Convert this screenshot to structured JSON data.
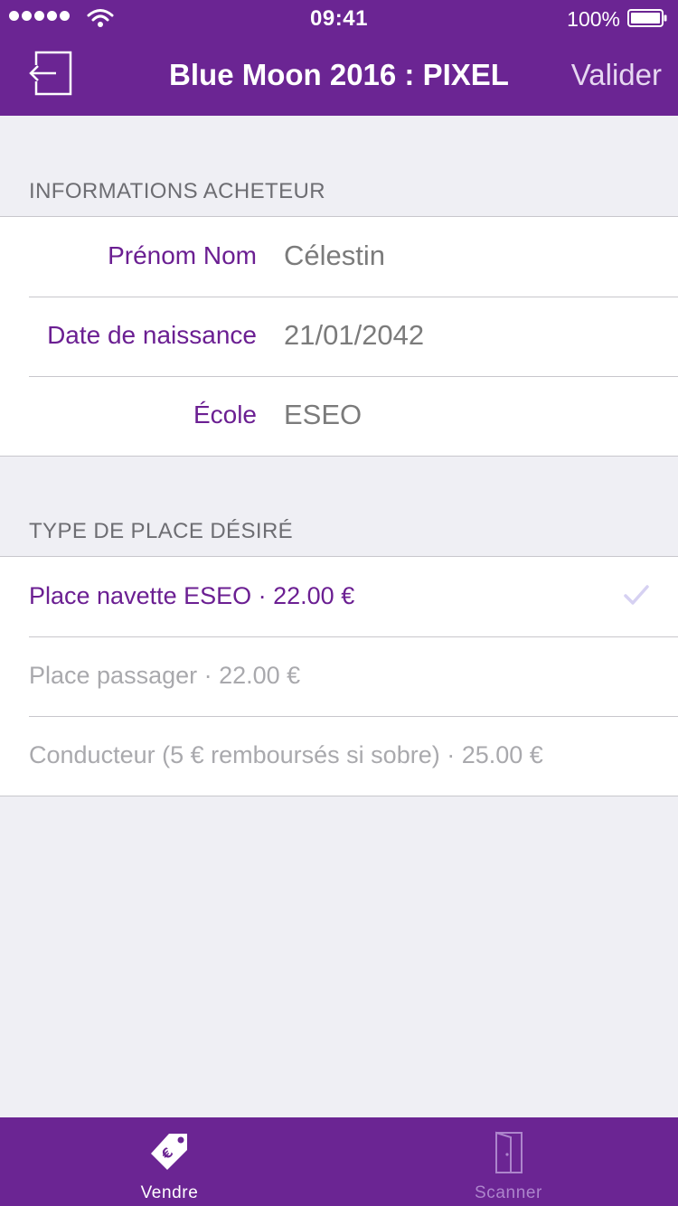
{
  "status_bar": {
    "time": "09:41",
    "battery": "100%",
    "signal_dots": 5,
    "wifi_icon": "wifi-icon",
    "battery_icon": "battery-icon"
  },
  "nav": {
    "back_icon": "exit-arrow-icon",
    "title": "Blue Moon 2016 : PIXEL",
    "action": "Valider"
  },
  "buyer_section": {
    "header": "INFORMATIONS ACHETEUR",
    "fields": [
      {
        "label": "Prénom Nom",
        "value": "Célestin"
      },
      {
        "label": "Date de naissance",
        "value": "21/01/2042"
      },
      {
        "label": "École",
        "value": "ESEO"
      }
    ]
  },
  "ticket_section": {
    "header": "TYPE DE PLACE DÉSIRÉ",
    "options": [
      {
        "label": "Place navette ESEO · 22.00 €",
        "selected": true
      },
      {
        "label": "Place passager · 22.00 €",
        "selected": false
      },
      {
        "label": "Conducteur (5 € remboursés si sobre) · 25.00 €",
        "selected": false
      }
    ]
  },
  "tab_bar": {
    "tabs": [
      {
        "label": "Vendre",
        "icon": "euro-tag-icon",
        "active": true
      },
      {
        "label": "Scanner",
        "icon": "door-icon",
        "active": false
      }
    ]
  },
  "colors": {
    "brand": "#6b2593",
    "accent_text": "#6b1f92",
    "background": "#efeff4",
    "checkmark": "#d6d1f2"
  }
}
